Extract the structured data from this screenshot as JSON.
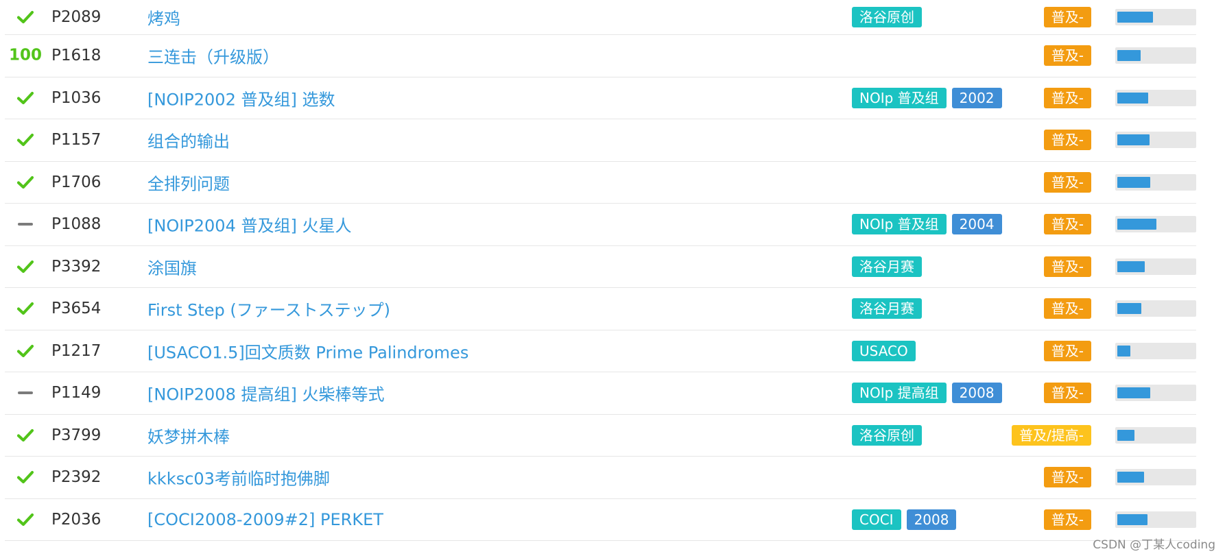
{
  "colors": {
    "accepted": "#52c41a",
    "link": "#3498db",
    "tag_source": "#1bc3c2",
    "tag_year": "#3f8ed6",
    "difficulty_entry": "#f39c11",
    "difficulty_entry_plus": "#fdc31d",
    "bar_fill": "#3498db",
    "bar_track": "#e7e7e7"
  },
  "problems": [
    {
      "status": "accepted",
      "status_icon": "check-icon",
      "pid": "P2089",
      "title": "烤鸡",
      "tags": [
        {
          "label": "洛谷原创",
          "kind": "source"
        }
      ],
      "difficulty": "普及-",
      "difficulty_level": "entry",
      "pass_rate": 0.46
    },
    {
      "status": "score",
      "score_text": "100",
      "pid": "P1618",
      "title": "三连击（升级版）",
      "tags": [],
      "difficulty": "普及-",
      "difficulty_level": "entry",
      "pass_rate": 0.3
    },
    {
      "status": "accepted",
      "status_icon": "check-icon",
      "pid": "P1036",
      "title": "[NOIP2002 普及组] 选数",
      "tags": [
        {
          "label": "NOIp 普及组",
          "kind": "source"
        },
        {
          "label": "2002",
          "kind": "year"
        }
      ],
      "difficulty": "普及-",
      "difficulty_level": "entry",
      "pass_rate": 0.4
    },
    {
      "status": "accepted",
      "status_icon": "check-icon",
      "pid": "P1157",
      "title": "组合的输出",
      "tags": [],
      "difficulty": "普及-",
      "difficulty_level": "entry",
      "pass_rate": 0.42
    },
    {
      "status": "accepted",
      "status_icon": "check-icon",
      "pid": "P1706",
      "title": "全排列问题",
      "tags": [],
      "difficulty": "普及-",
      "difficulty_level": "entry",
      "pass_rate": 0.43
    },
    {
      "status": "attempted",
      "status_icon": "dash-icon",
      "pid": "P1088",
      "title": "[NOIP2004 普及组] 火星人",
      "tags": [
        {
          "label": "NOIp 普及组",
          "kind": "source"
        },
        {
          "label": "2004",
          "kind": "year"
        }
      ],
      "difficulty": "普及-",
      "difficulty_level": "entry",
      "pass_rate": 0.51
    },
    {
      "status": "accepted",
      "status_icon": "check-icon",
      "pid": "P3392",
      "title": "涂国旗",
      "tags": [
        {
          "label": "洛谷月赛",
          "kind": "source"
        }
      ],
      "difficulty": "普及-",
      "difficulty_level": "entry",
      "pass_rate": 0.36
    },
    {
      "status": "accepted",
      "status_icon": "check-icon",
      "pid": "P3654",
      "title": "First Step (ファーストステップ)",
      "tags": [
        {
          "label": "洛谷月赛",
          "kind": "source"
        }
      ],
      "difficulty": "普及-",
      "difficulty_level": "entry",
      "pass_rate": 0.31
    },
    {
      "status": "accepted",
      "status_icon": "check-icon",
      "pid": "P1217",
      "title": "[USACO1.5]回文质数 Prime Palindromes",
      "tags": [
        {
          "label": "USACO",
          "kind": "source"
        }
      ],
      "difficulty": "普及-",
      "difficulty_level": "entry",
      "pass_rate": 0.17
    },
    {
      "status": "attempted",
      "status_icon": "dash-icon",
      "pid": "P1149",
      "title": "[NOIP2008 提高组] 火柴棒等式",
      "tags": [
        {
          "label": "NOIp 提高组",
          "kind": "source"
        },
        {
          "label": "2008",
          "kind": "year"
        }
      ],
      "difficulty": "普及-",
      "difficulty_level": "entry",
      "pass_rate": 0.43
    },
    {
      "status": "accepted",
      "status_icon": "check-icon",
      "pid": "P3799",
      "title": "妖梦拼木棒",
      "tags": [
        {
          "label": "洛谷原创",
          "kind": "source"
        }
      ],
      "difficulty": "普及/提高-",
      "difficulty_level": "entry-plus",
      "pass_rate": 0.22
    },
    {
      "status": "accepted",
      "status_icon": "check-icon",
      "pid": "P2392",
      "title": "kkksc03考前临时抱佛脚",
      "tags": [],
      "difficulty": "普及-",
      "difficulty_level": "entry",
      "pass_rate": 0.35
    },
    {
      "status": "accepted",
      "status_icon": "check-icon",
      "pid": "P2036",
      "title": "[COCI2008-2009#2] PERKET",
      "tags": [
        {
          "label": "COCI",
          "kind": "source"
        },
        {
          "label": "2008",
          "kind": "year"
        }
      ],
      "difficulty": "普及-",
      "difficulty_level": "entry",
      "pass_rate": 0.39
    }
  ],
  "watermark": "CSDN @丁某人coding"
}
